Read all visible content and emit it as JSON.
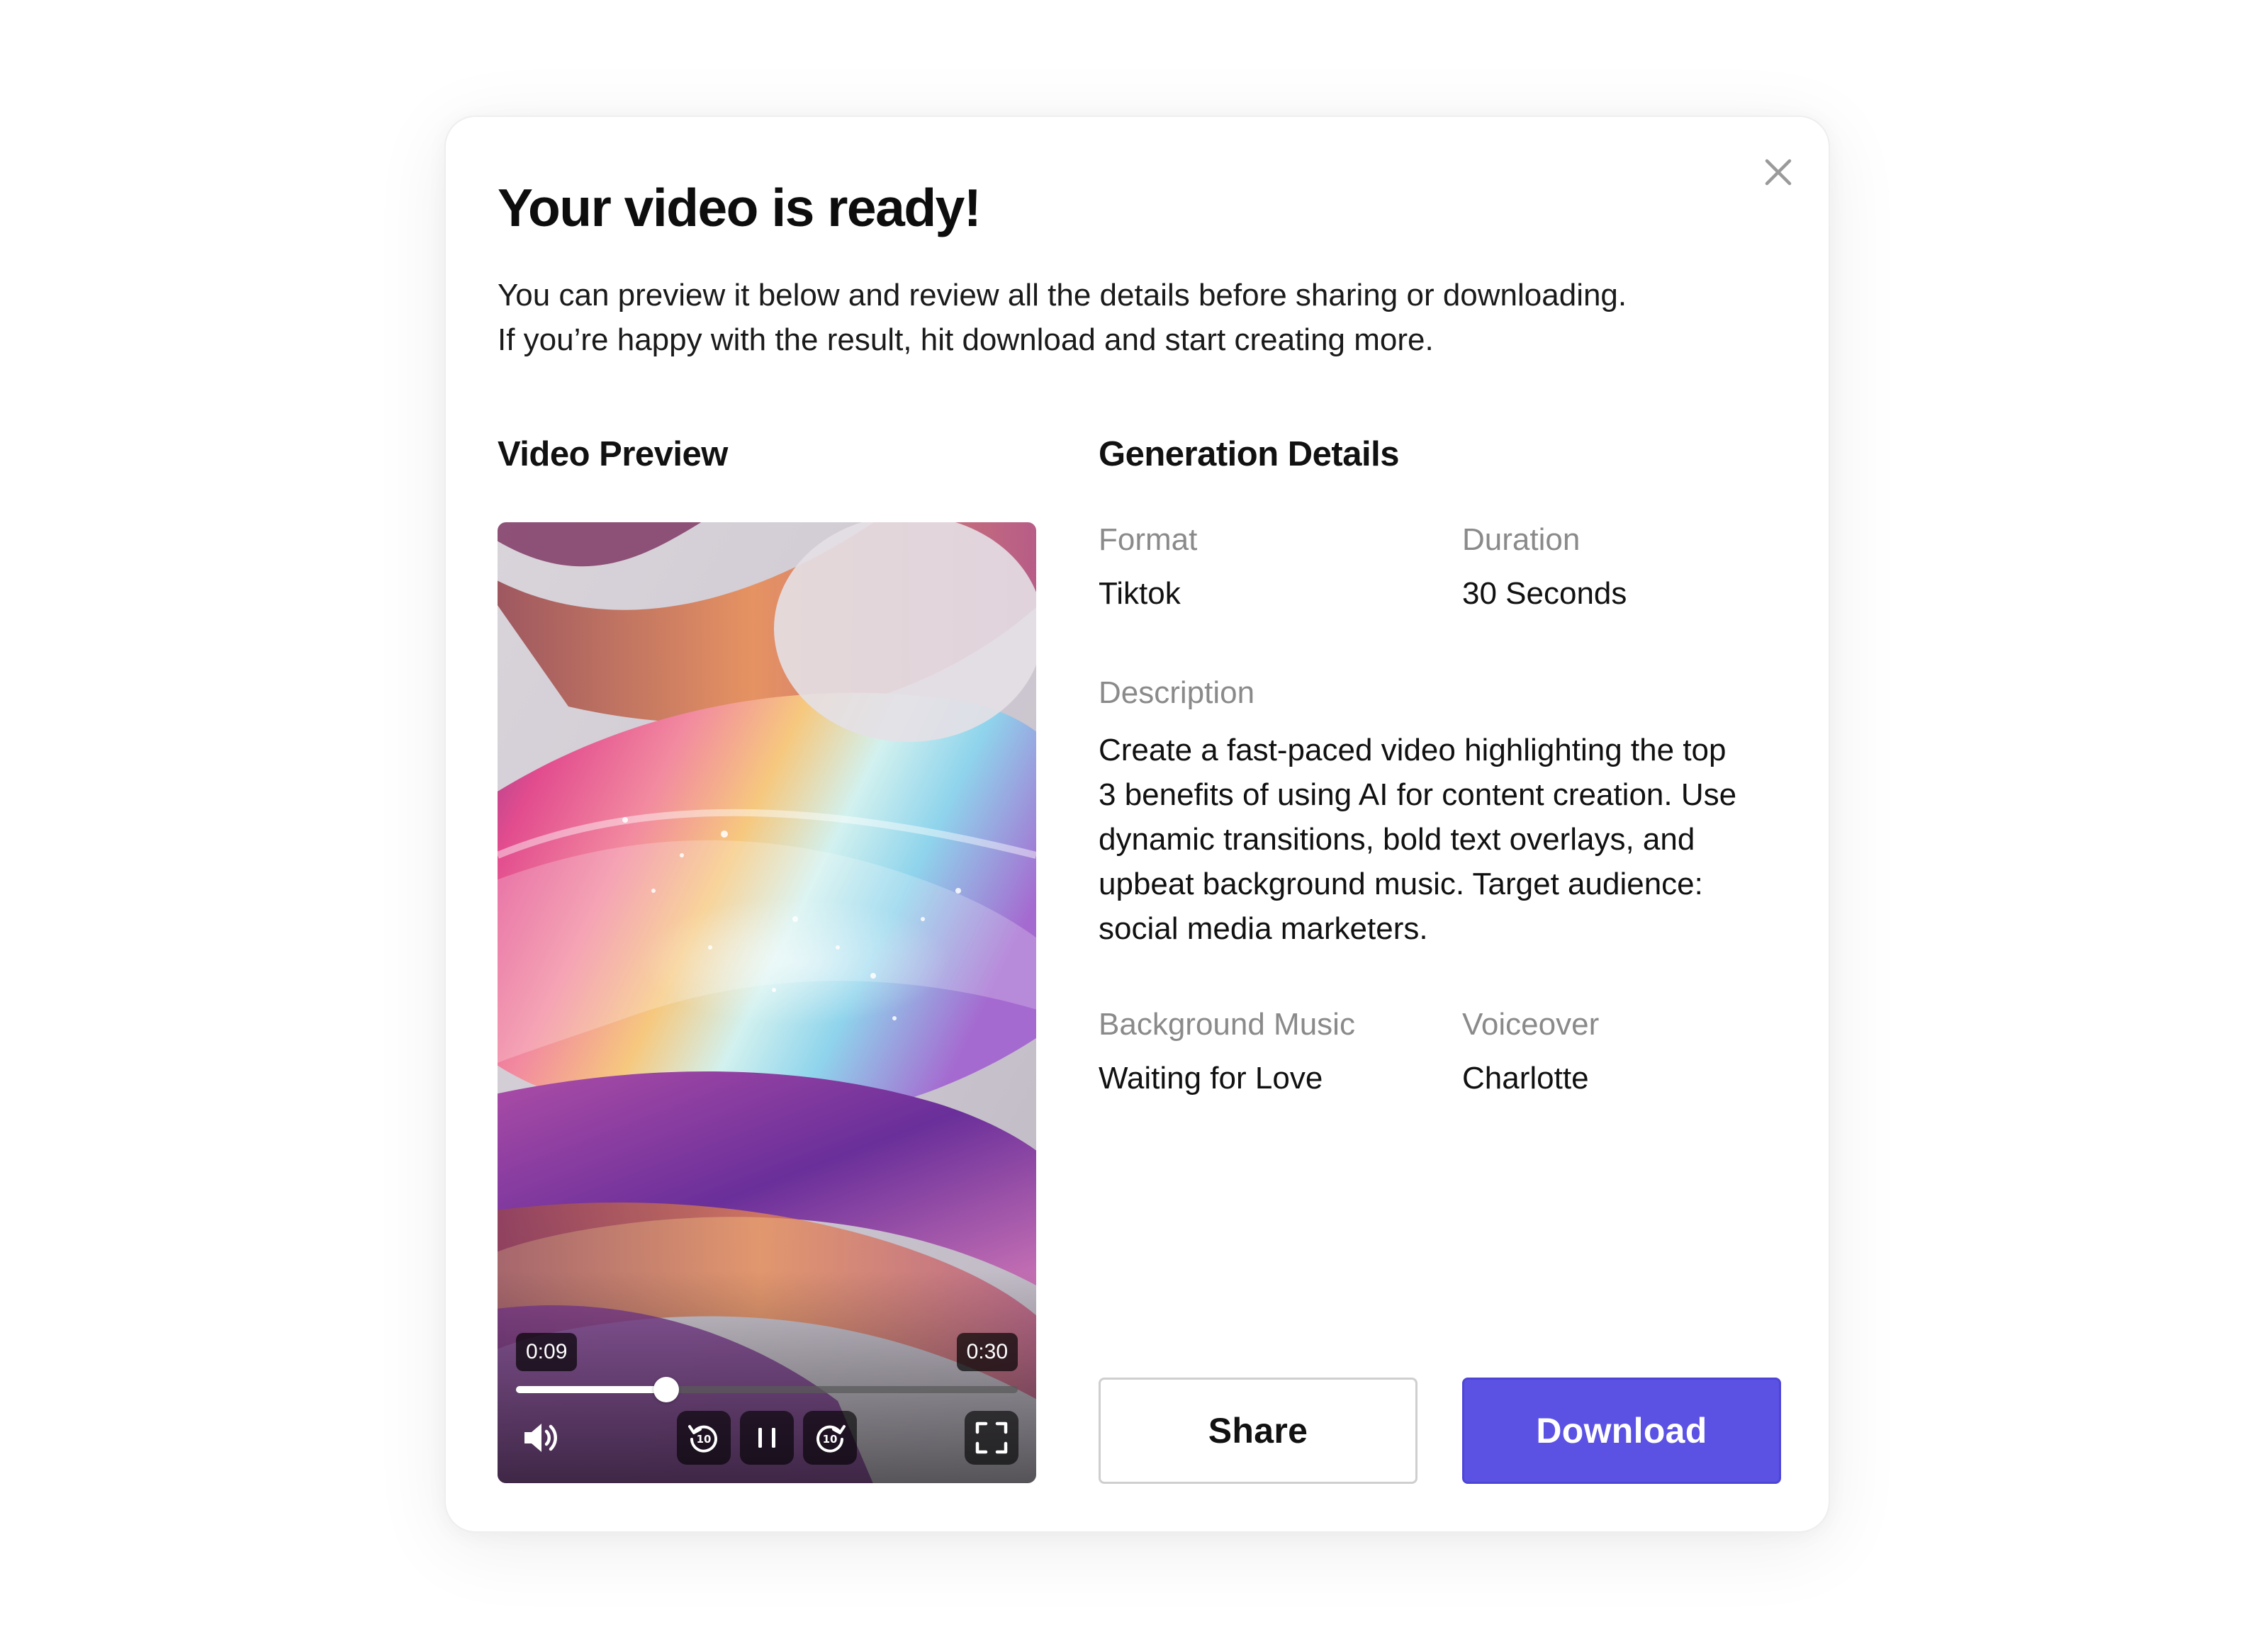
{
  "dialog": {
    "title": "Your video is ready!",
    "subtitle_lines": [
      "You can preview it below and review all the details before sharing or downloading.",
      "If you’re happy with the result, hit download and start creating more."
    ],
    "close_icon": "close-icon"
  },
  "preview": {
    "heading": "Video Preview",
    "current_time": "0:09",
    "total_time": "0:30",
    "progress_fraction": 0.3,
    "icons": {
      "volume": "volume-icon",
      "rewind": "rewind-10-icon",
      "pause": "pause-icon",
      "forward": "forward-10-icon",
      "fullscreen": "fullscreen-icon"
    }
  },
  "details": {
    "heading": "Generation Details",
    "format": {
      "label": "Format",
      "value": "Tiktok"
    },
    "duration": {
      "label": "Duration",
      "value": "30 Seconds"
    },
    "description": {
      "label": "Description",
      "lines": [
        "Create a fast-paced video highlighting the top",
        "3 benefits of using AI for content creation. Use",
        "dynamic transitions, bold text overlays, and",
        "upbeat background music. Target audience:",
        "social media marketers."
      ]
    },
    "music": {
      "label": "Background Music",
      "value": "Waiting for Love"
    },
    "voiceover": {
      "label": "Voiceover",
      "value": "Charlotte"
    }
  },
  "actions": {
    "share_label": "Share",
    "download_label": "Download"
  },
  "colors": {
    "accent": "#5b52e4",
    "label_gray": "#8a8a8a",
    "text": "#111111"
  }
}
